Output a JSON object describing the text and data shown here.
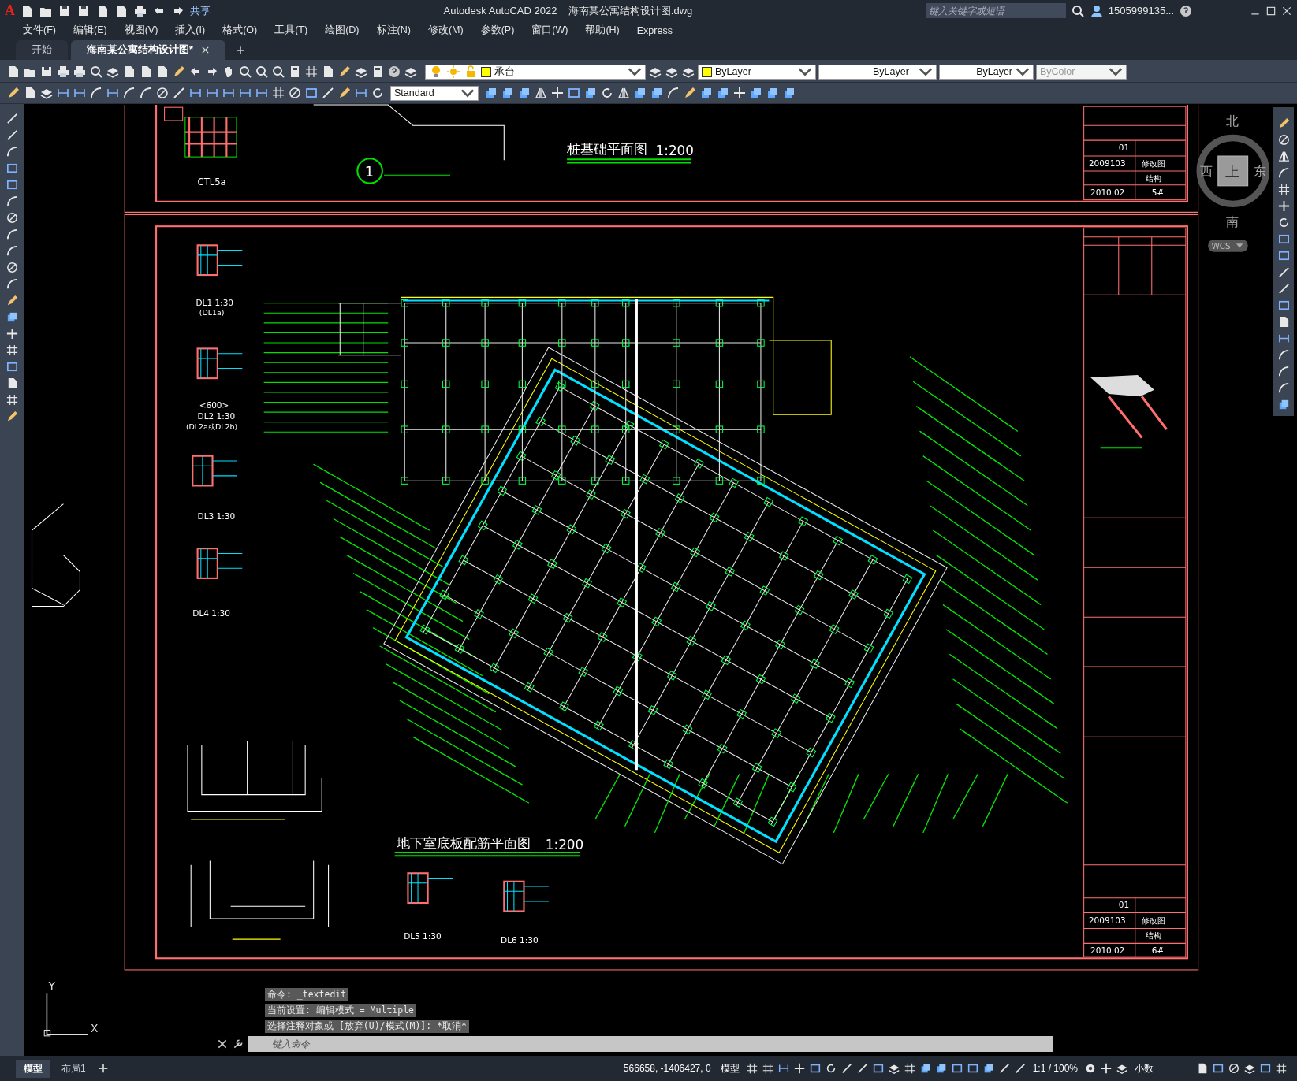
{
  "window": {
    "logo": "A",
    "app_title": "Autodesk AutoCAD 2022",
    "file_title": "海南某公寓结构设计图.dwg",
    "share": "共享",
    "search": {
      "placeholder": "键入关键字或短语"
    },
    "user": "1505999135..."
  },
  "menu": [
    "文件(F)",
    "编辑(E)",
    "视图(V)",
    "插入(I)",
    "格式(O)",
    "工具(T)",
    "绘图(D)",
    "标注(N)",
    "修改(M)",
    "参数(P)",
    "窗口(W)",
    "帮助(H)",
    "Express"
  ],
  "doc_tabs": [
    {
      "label": "开始",
      "selected": false
    },
    {
      "label": "海南某公寓结构设计图*",
      "selected": true
    }
  ],
  "layer": {
    "name": "承台"
  },
  "properties": [
    {
      "value": "ByLayer",
      "kind": "color",
      "disabled": false
    },
    {
      "value": "ByLayer",
      "kind": "linetype",
      "disabled": false
    },
    {
      "value": "ByLayer",
      "kind": "lineweight",
      "disabled": false
    },
    {
      "value": "ByColor",
      "kind": "plain",
      "disabled": true
    }
  ],
  "text_style": "Standard",
  "drawing": {
    "pile_plan": {
      "title": "桩基础平面图",
      "scale": "1:200",
      "detail_label": "CTL5a",
      "callout": "1"
    },
    "slab_plan": {
      "title": "地下室底板配筋平面图",
      "scale": "1:200"
    },
    "details": [
      {
        "label": "DL1 1:30",
        "sub": "(DL1a)"
      },
      {
        "label": "DL2 1:30",
        "sub": "(DL2a或DL2b)",
        "note": "<600>"
      },
      {
        "label": "DL3 1:30"
      },
      {
        "label": "DL4 1:30"
      },
      {
        "label": "DL5 1:30"
      },
      {
        "label": "DL6 1:30"
      }
    ],
    "title_blocks": [
      {
        "version": "01",
        "project_no": "2009103",
        "stage": "修改图",
        "discipline": "结构",
        "date": "2010.02",
        "sheet": "5#"
      },
      {
        "version": "01",
        "project_no": "2009103",
        "stage": "修改图",
        "discipline": "结构",
        "date": "2010.02",
        "sheet": "6#"
      }
    ]
  },
  "viewcube": {
    "north": "北",
    "east": "东",
    "south": "南",
    "west": "西",
    "face": "上",
    "ucs": "WCS"
  },
  "ucs_axes": {
    "x": "X",
    "y": "Y"
  },
  "command_history": [
    "命令: _textedit",
    "当前设置: 编辑模式 = Multiple",
    "选择注释对象或 [放弃(U)/模式(M)]: *取消*"
  ],
  "command_line": {
    "placeholder": "键入命令"
  },
  "layout_tabs": [
    {
      "label": "模型",
      "selected": true
    },
    {
      "label": "布局1",
      "selected": false
    }
  ],
  "status_bar": {
    "coordinates": "566658, -1406427, 0",
    "space": "模型",
    "scale": "1:1 / 100%",
    "units": "小数"
  }
}
